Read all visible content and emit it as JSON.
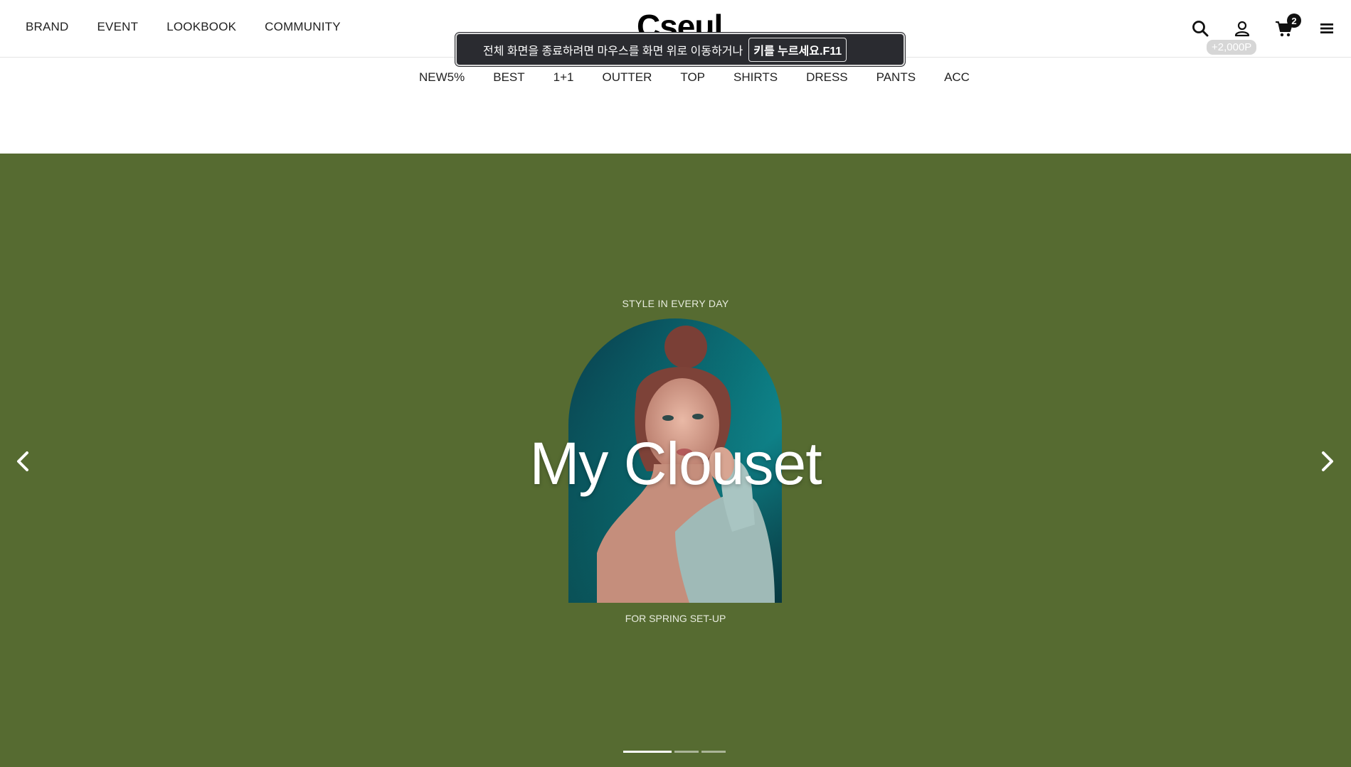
{
  "header": {
    "nav": [
      "BRAND",
      "EVENT",
      "LOOKBOOK",
      "COMMUNITY"
    ],
    "logo": "Cseul",
    "cart_count": "2",
    "points": "+2,000P",
    "icons": [
      "search-icon",
      "user-icon",
      "cart-icon",
      "menu-icon"
    ]
  },
  "fullscreen_notice": {
    "message": "전체 화면을 종료하려면 마우스를 화면 위로 이동하거나",
    "key_text": "키를 누르세요.F11"
  },
  "categories": [
    "NEW5%",
    "BEST",
    "1+1",
    "OUTTER",
    "TOP",
    "SHIRTS",
    "DRESS",
    "PANTS",
    "ACC"
  ],
  "hero": {
    "kicker": "STYLE IN EVERY DAY",
    "title": "My Clouset",
    "subtitle": "FOR SPRING SET-UP",
    "background_color": "#566b31",
    "slide_count": 3,
    "active_slide": 1
  }
}
